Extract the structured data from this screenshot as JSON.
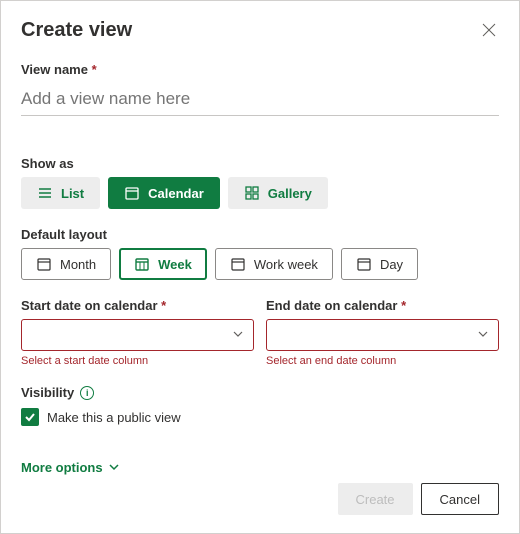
{
  "title": "Create view",
  "viewName": {
    "label": "View name",
    "required": "*",
    "placeholder": "Add a view name here",
    "value": ""
  },
  "showAs": {
    "label": "Show as",
    "options": [
      {
        "label": "List",
        "icon": "list-icon",
        "selected": false
      },
      {
        "label": "Calendar",
        "icon": "calendar-icon",
        "selected": true
      },
      {
        "label": "Gallery",
        "icon": "gallery-icon",
        "selected": false
      }
    ]
  },
  "defaultLayout": {
    "label": "Default layout",
    "options": [
      {
        "label": "Month",
        "icon": "calendar-month-icon",
        "selected": false
      },
      {
        "label": "Week",
        "icon": "calendar-week-icon",
        "selected": true
      },
      {
        "label": "Work week",
        "icon": "calendar-work-icon",
        "selected": false
      },
      {
        "label": "Day",
        "icon": "calendar-day-icon",
        "selected": false
      }
    ]
  },
  "startDate": {
    "label": "Start date on calendar",
    "required": "*",
    "error": "Select a start date column"
  },
  "endDate": {
    "label": "End date on calendar",
    "required": "*",
    "error": "Select an end date column"
  },
  "visibility": {
    "label": "Visibility",
    "checkboxLabel": "Make this a public view",
    "checked": true
  },
  "moreOptions": "More options",
  "footer": {
    "create": "Create",
    "cancel": "Cancel"
  }
}
